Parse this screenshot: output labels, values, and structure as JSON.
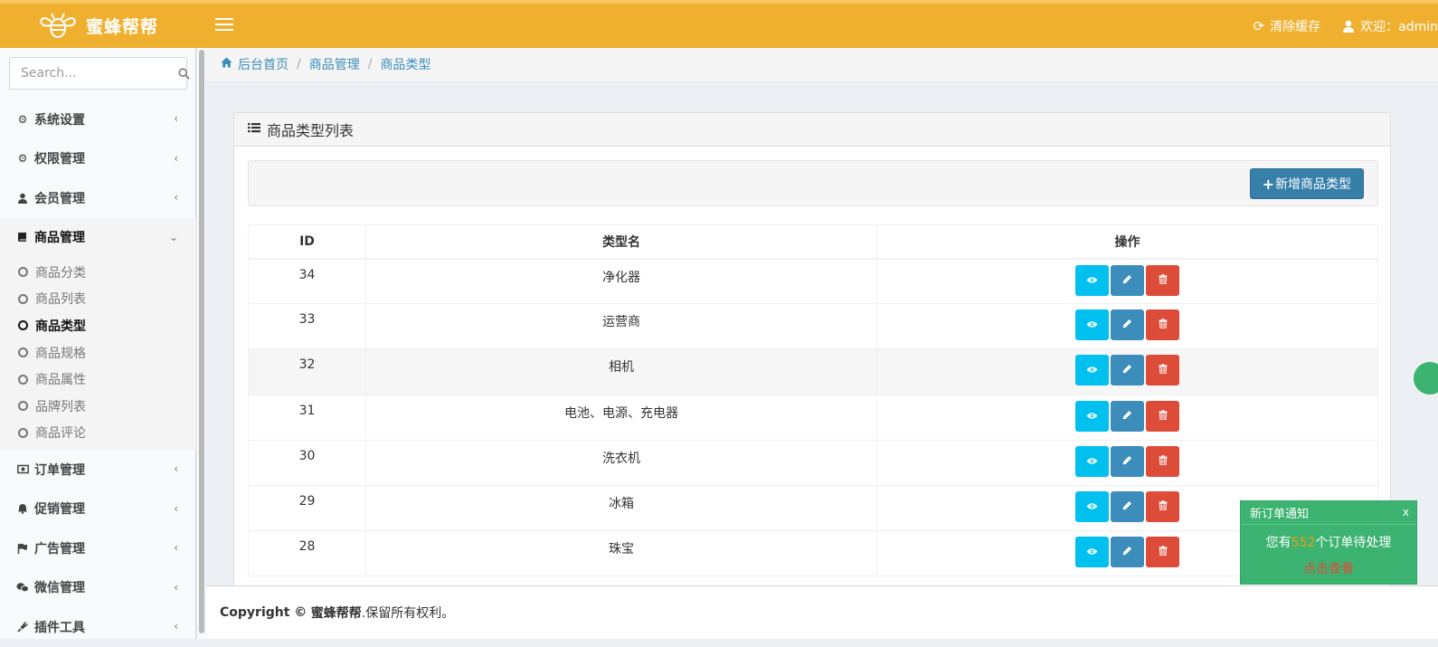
{
  "app": {
    "brand": "蜜蜂帮帮"
  },
  "topbar": {
    "clear_cache": "清除缓存",
    "welcome": "欢迎：admin"
  },
  "sidebar": {
    "search_placeholder": "Search...",
    "items": [
      {
        "label": "系统设置",
        "icon": "gear-icon"
      },
      {
        "label": "权限管理",
        "icon": "cogs-icon"
      },
      {
        "label": "会员管理",
        "icon": "user-icon"
      },
      {
        "label": "商品管理",
        "icon": "book-icon",
        "open": true
      },
      {
        "label": "订单管理",
        "icon": "money-icon"
      },
      {
        "label": "促销管理",
        "icon": "bell-icon"
      },
      {
        "label": "广告管理",
        "icon": "flag-icon"
      },
      {
        "label": "微信管理",
        "icon": "wechat-icon"
      },
      {
        "label": "插件工具",
        "icon": "plug-icon"
      }
    ],
    "sub_items": [
      {
        "label": "商品分类"
      },
      {
        "label": "商品列表"
      },
      {
        "label": "商品类型",
        "active": true
      },
      {
        "label": "商品规格"
      },
      {
        "label": "商品属性"
      },
      {
        "label": "品牌列表"
      },
      {
        "label": "商品评论"
      }
    ]
  },
  "breadcrumb": [
    "后台首页",
    "商品管理",
    "商品类型"
  ],
  "panel": {
    "title": "商品类型列表",
    "add_button": "新增商品类型"
  },
  "table": {
    "headers": [
      "ID",
      "类型名",
      "操作"
    ],
    "rows": [
      {
        "id": "34",
        "name": "净化器"
      },
      {
        "id": "33",
        "name": "运营商"
      },
      {
        "id": "32",
        "name": "相机"
      },
      {
        "id": "31",
        "name": "电池、电源、充电器"
      },
      {
        "id": "30",
        "name": "洗衣机"
      },
      {
        "id": "29",
        "name": "冰箱"
      },
      {
        "id": "28",
        "name": "珠宝"
      }
    ]
  },
  "footer": {
    "prefix": "Copyright ©",
    "brand": "蜜蜂帮帮",
    "suffix": ".保留所有权利。"
  },
  "notice": {
    "title": "新订单通知",
    "close": "x",
    "text_before": "您有",
    "count": "552",
    "text_after": "个订单待处理",
    "link": "点击查看"
  },
  "colors": {
    "topbar": "#f0b02f",
    "primary": "#3c8dbc",
    "info": "#00c0ef",
    "danger": "#dd4b39",
    "notice_bg": "#3cb371"
  }
}
